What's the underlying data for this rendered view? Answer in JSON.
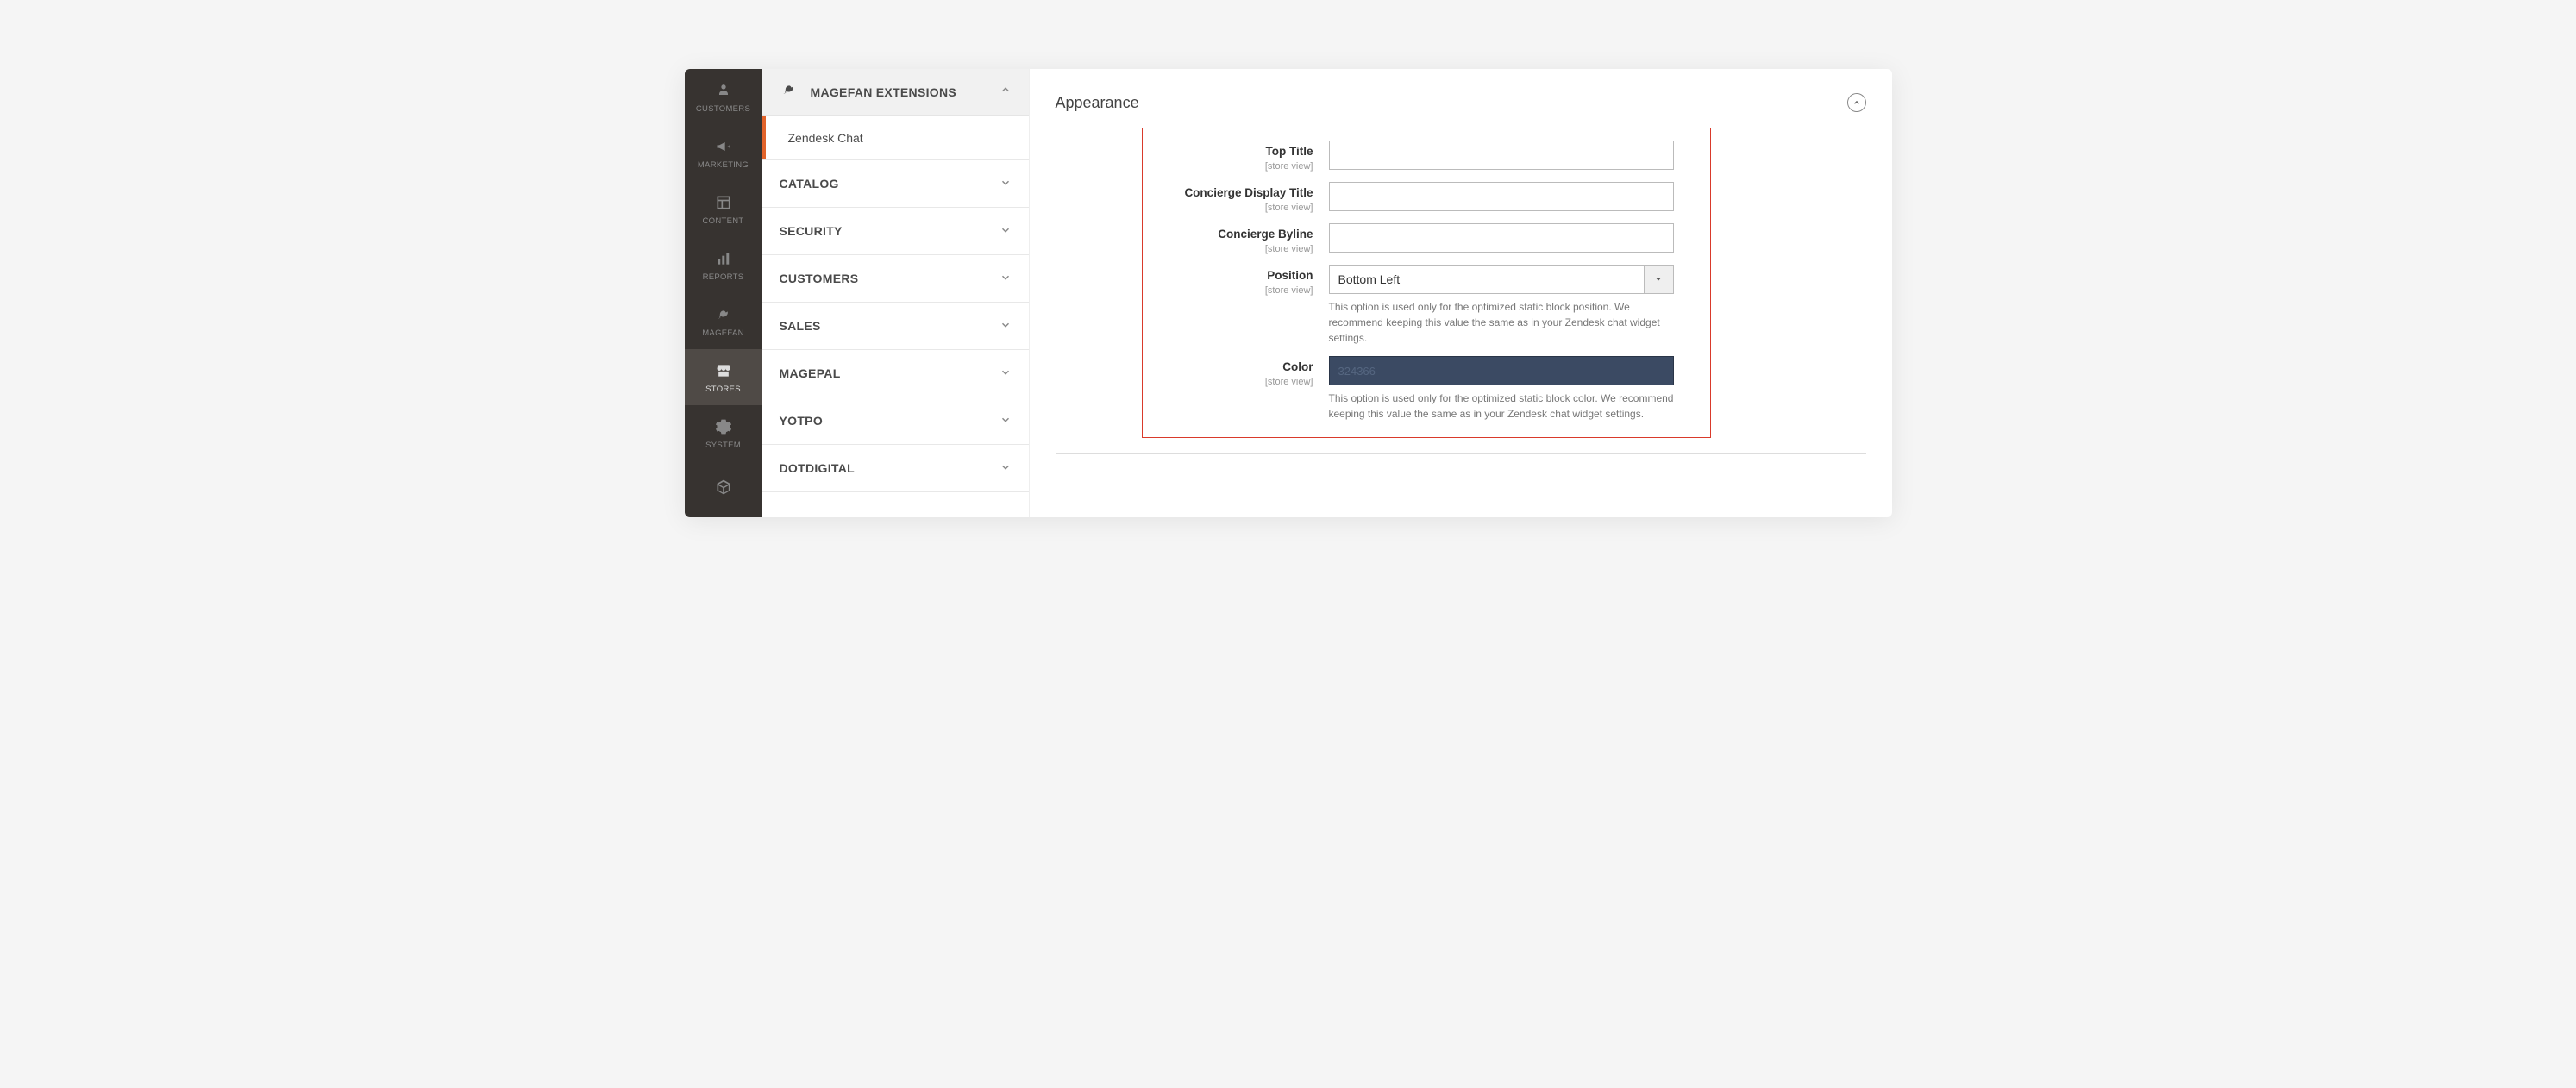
{
  "nav": {
    "items": [
      {
        "label": "CUSTOMERS",
        "icon": "user"
      },
      {
        "label": "MARKETING",
        "icon": "megaphone"
      },
      {
        "label": "CONTENT",
        "icon": "layout"
      },
      {
        "label": "REPORTS",
        "icon": "bars"
      },
      {
        "label": "MAGEFAN",
        "icon": "bird"
      },
      {
        "label": "STORES",
        "icon": "store",
        "active": true
      },
      {
        "label": "SYSTEM",
        "icon": "gear"
      },
      {
        "label": "",
        "icon": "cube"
      }
    ]
  },
  "panel": {
    "header": "MAGEFAN EXTENSIONS",
    "activeItem": "Zendesk Chat",
    "groups": [
      "CATALOG",
      "SECURITY",
      "CUSTOMERS",
      "SALES",
      "MAGEPAL",
      "YOTPO",
      "DOTDIGITAL"
    ]
  },
  "section": {
    "title": "Appearance",
    "scope_text": "[store view]",
    "fields": {
      "top_title": {
        "label": "Top Title",
        "value": ""
      },
      "concierge_title": {
        "label": "Concierge Display Title",
        "value": ""
      },
      "concierge_byline": {
        "label": "Concierge Byline",
        "value": ""
      },
      "position": {
        "label": "Position",
        "value": "Bottom Left",
        "help": "This option is used only for the optimized static block position. We recommend keeping this value the same as in your Zendesk chat widget settings."
      },
      "color": {
        "label": "Color",
        "value": "324366",
        "help": "This option is used only for the optimized static block color. We recommend keeping this value the same as in your Zendesk chat widget settings."
      }
    }
  }
}
